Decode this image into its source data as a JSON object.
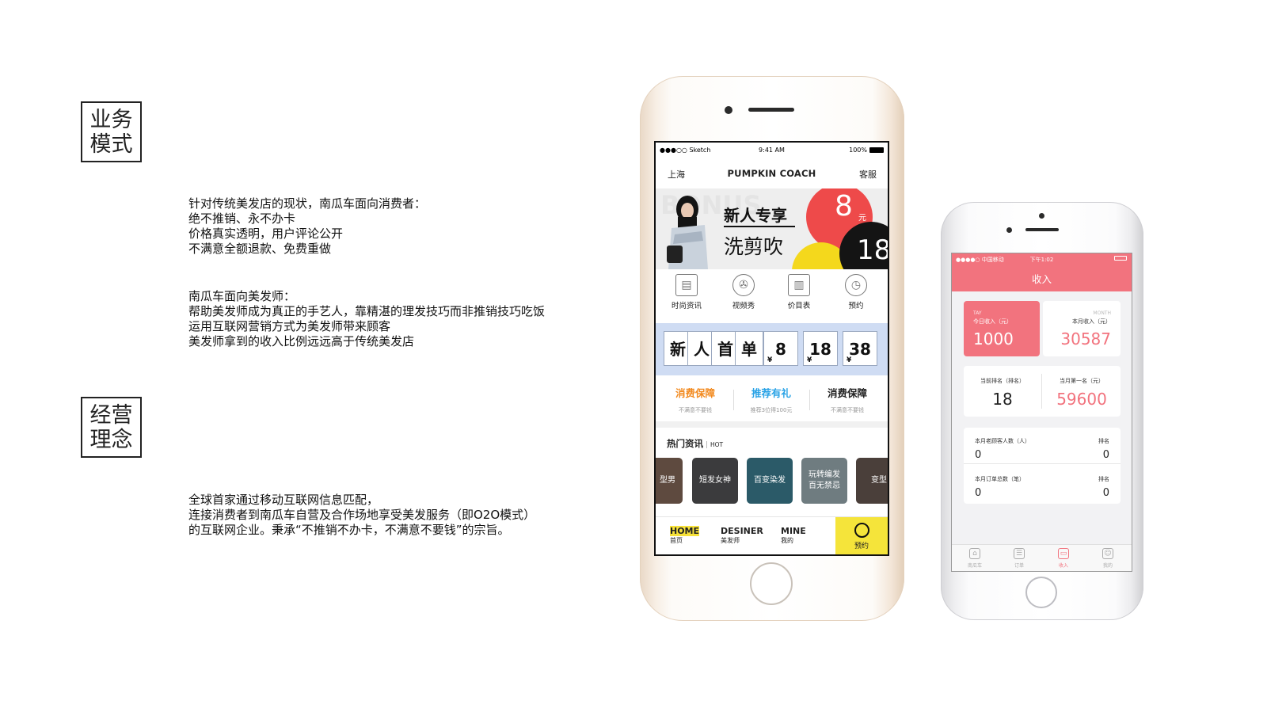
{
  "left": {
    "section1_title": [
      "业务",
      "模式"
    ],
    "section1_para1": [
      "针对传统美发店的现状，南瓜车面向消费者：",
      "绝不推销、永不办卡",
      "价格真实透明，用户评论公开",
      "不满意全额退款、免费重做"
    ],
    "section1_para2": [
      "南瓜车面向美发师：",
      "帮助美发师成为真正的手艺人，靠精湛的理发技巧而非推销技巧吃饭",
      "运用互联网营销方式为美发师带来顾客",
      "美发师拿到的收入比例远远高于传统美发店"
    ],
    "section2_title": [
      "经营",
      "理念"
    ],
    "section2_para": [
      "全球首家通过移动互联网信息匹配，",
      "连接消费者到南瓜车自营及合作场地享受美发服务（即O2O模式）",
      "的互联网企业。秉承“不推销不办卡，不满意不要钱”的宗旨。"
    ]
  },
  "phone1": {
    "status": {
      "carrier": "●●●○○ Sketch",
      "time": "9:41 AM",
      "battery": "100%"
    },
    "nav": {
      "city": "上海",
      "title": "PUMPKIN COACH",
      "service": "客服"
    },
    "banner": {
      "bg_word": "BONUS",
      "headline": "新人专享",
      "subline": "洗剪吹",
      "price_small": "8",
      "price_unit": "元",
      "price_big": "18"
    },
    "icons": [
      {
        "label": "时尚资讯",
        "icon": "news-icon",
        "glyph": "▤"
      },
      {
        "label": "视频秀",
        "icon": "film-reel-icon",
        "glyph": "✇"
      },
      {
        "label": "价目表",
        "icon": "book-icon",
        "glyph": "▥"
      },
      {
        "label": "预约",
        "icon": "clock-icon",
        "glyph": "◷"
      }
    ],
    "promo": {
      "chars": [
        "新",
        "人",
        "首",
        "单"
      ],
      "prices": [
        {
          "currency": "¥",
          "value": "8"
        },
        {
          "currency": "¥",
          "value": "18"
        },
        {
          "currency": "¥",
          "value": "38"
        }
      ]
    },
    "guarantees": [
      {
        "title": "消费保障",
        "sub": "不满意不要钱",
        "color": "#f28a1f"
      },
      {
        "title": "推荐有礼",
        "sub": "推荐3位得100元",
        "color": "#2aa3e6"
      },
      {
        "title": "消费保障",
        "sub": "不满意不要钱",
        "color": "#222222"
      }
    ],
    "hot": {
      "title": "热门资讯",
      "tag": "HOT"
    },
    "cards": [
      {
        "text": "型男",
        "bg": "#5e4a3f"
      },
      {
        "text": "短发女神",
        "bg": "#3b3b3d"
      },
      {
        "text": "百变染发",
        "bg": "#2b5a68"
      },
      {
        "text": "玩转编发\n百无禁忌",
        "bg": "#6f7c80"
      },
      {
        "text": "变型",
        "bg": "#4a3f3a"
      }
    ],
    "tabs": [
      {
        "en": "HOME",
        "cn": "首页",
        "active": true
      },
      {
        "en": "DESINER",
        "cn": "美发师",
        "active": false
      },
      {
        "en": "MINE",
        "cn": "我的",
        "active": false
      }
    ],
    "book": "预约"
  },
  "phone2": {
    "status": {
      "carrier": "●●●●○ 中国移动",
      "time": "下午1:02"
    },
    "title": "收入",
    "today": {
      "en": "TAY",
      "label": "今日收入（元）",
      "value": "1000"
    },
    "month": {
      "en": "MONTH",
      "label": "本月收入（元）",
      "value": "30587"
    },
    "rank": {
      "label": "当前排名（排名）",
      "value": "18",
      "top_label": "当月第一名（元）",
      "top_value": "59600"
    },
    "stats": [
      {
        "label": "本月老顾客人数（人）",
        "value": "0",
        "rank_label": "排名",
        "rank_value": "0"
      },
      {
        "label": "本月订单总数（笔）",
        "value": "0",
        "rank_label": "排名",
        "rank_value": "0"
      }
    ],
    "tabs": [
      {
        "label": "南瓜车",
        "icon": "home-icon",
        "glyph": "⌂",
        "active": false
      },
      {
        "label": "订单",
        "icon": "list-icon",
        "glyph": "☰",
        "active": false
      },
      {
        "label": "收入",
        "icon": "wallet-icon",
        "glyph": "▭",
        "active": true
      },
      {
        "label": "我的",
        "icon": "profile-icon",
        "glyph": "☺",
        "active": false
      }
    ]
  }
}
